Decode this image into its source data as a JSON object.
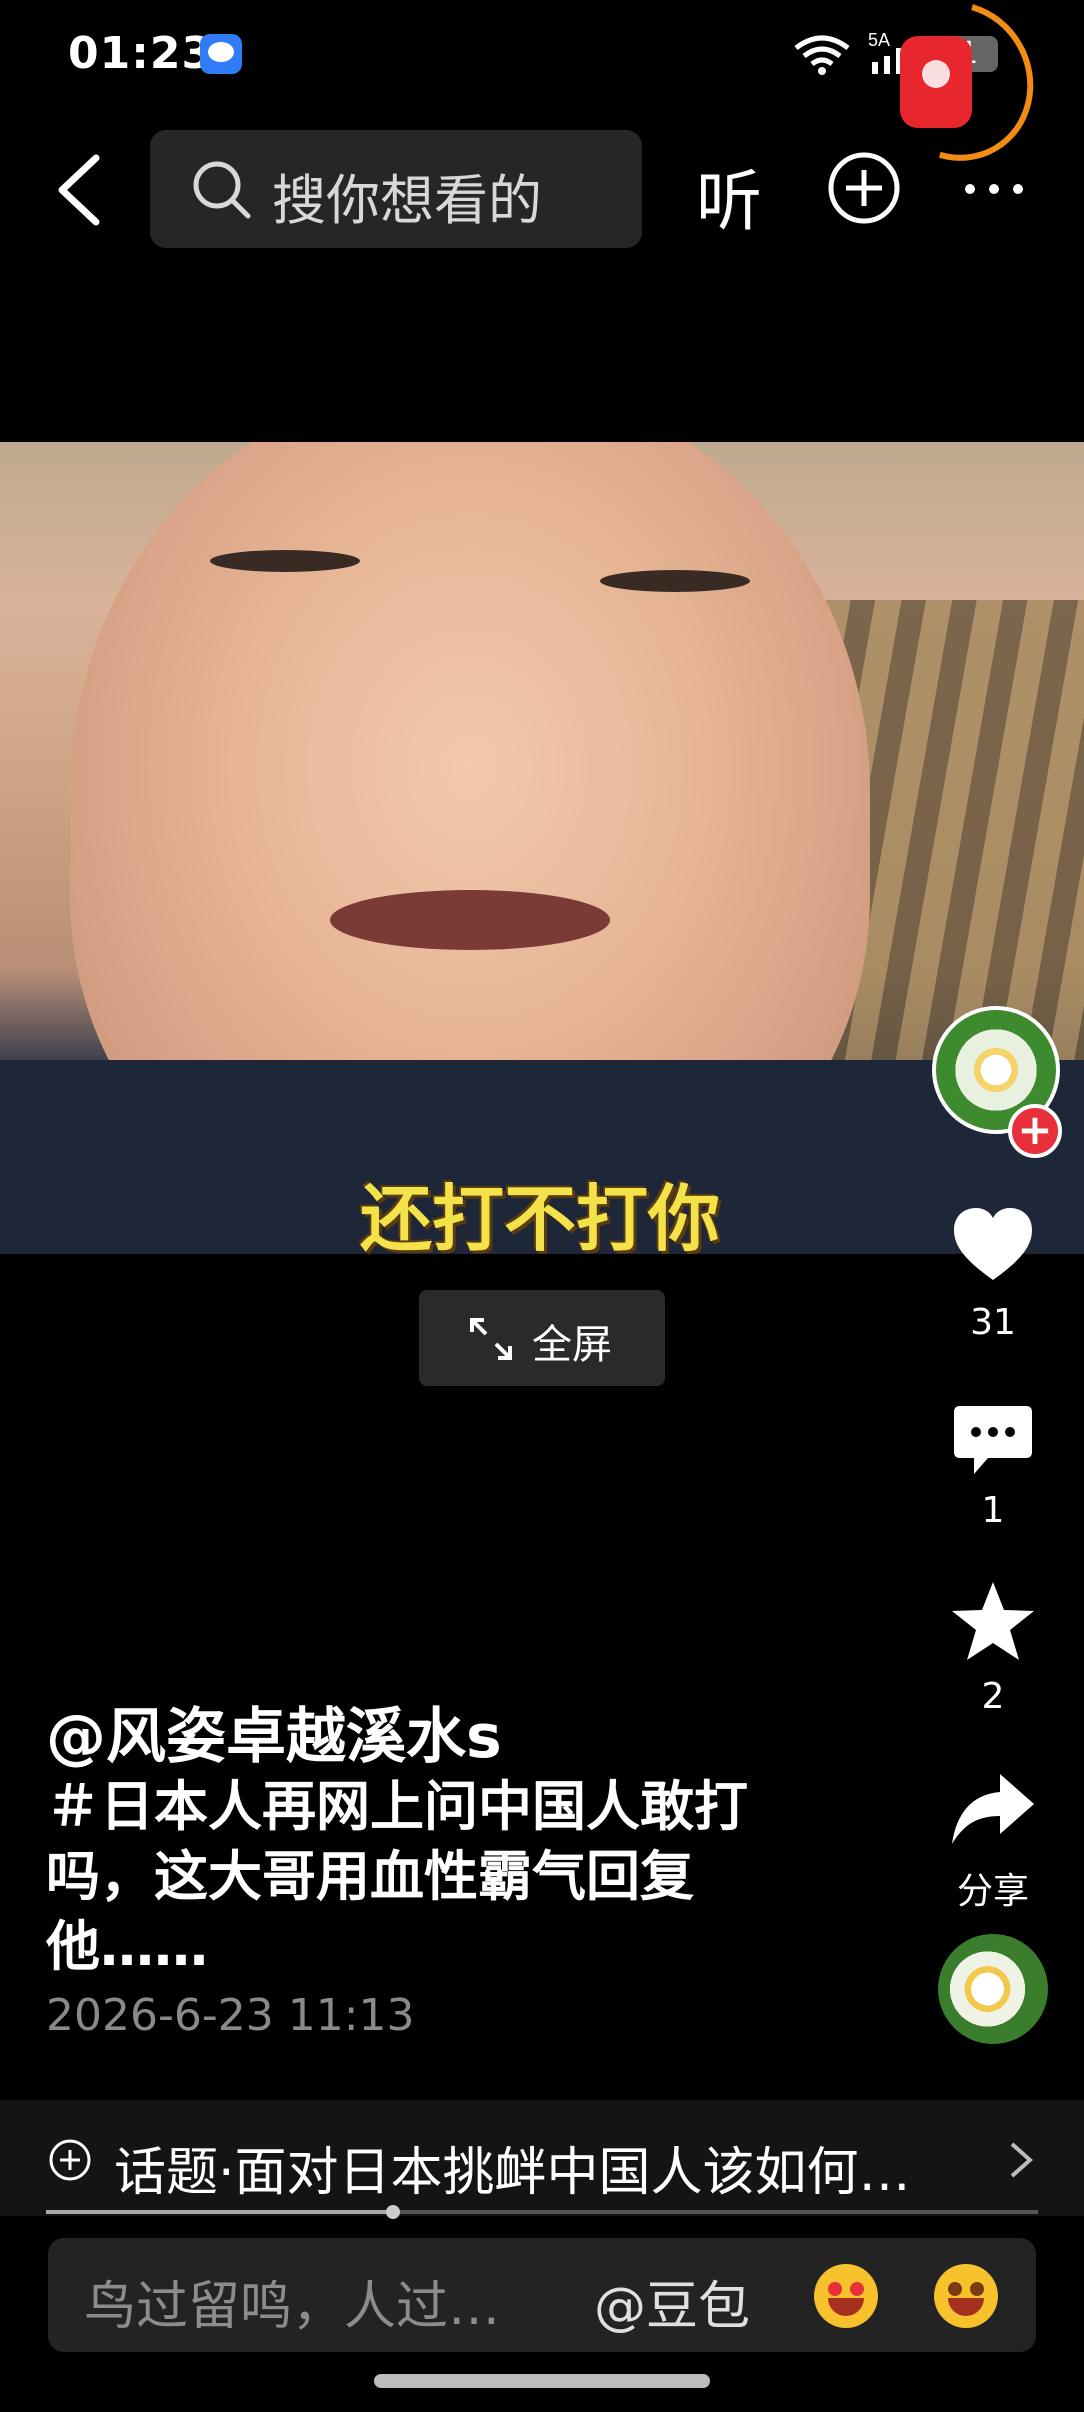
{
  "status_bar": {
    "time": "01:23",
    "network": "5A",
    "battery": "31"
  },
  "top_nav": {
    "search_placeholder": "搜你想看的",
    "listen_label": "听"
  },
  "video": {
    "subtitle": "还打不打你",
    "fullscreen_label": "全屏"
  },
  "actions": {
    "likes": "31",
    "comments": "1",
    "favorites": "2",
    "share_label": "分享"
  },
  "post": {
    "author": "@风姿卓越溪水s",
    "description": "＃日本人再网上问中国人敢打吗，这大哥用血性霸气回复他……",
    "date": "2026-6-23 11:13"
  },
  "topic": {
    "text": "话题·面对日本挑衅中国人该如何…"
  },
  "comment_bar": {
    "placeholder": "鸟过留鸣，人过…",
    "mention": "@豆包"
  },
  "colors": {
    "accent_red": "#e8303c",
    "subtitle_yellow": "#f4e24a"
  }
}
